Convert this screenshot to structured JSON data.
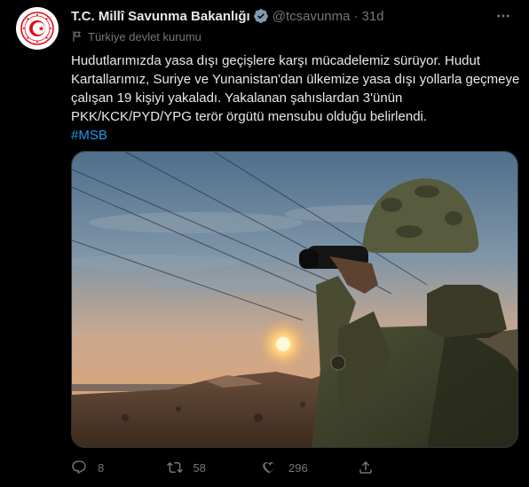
{
  "author": {
    "display_name": "T.C. Millî Savunma Bakanlığı",
    "handle": "@tcsavunma",
    "separator": "·",
    "time": "31d",
    "verified": true,
    "affiliation_label": "Türkiye devlet kurumu"
  },
  "tweet": {
    "lines": [
      "Hudutlarımızda yasa dışı geçişlere karşı mücadelemiz sürüyor. Hudut",
      "Kartallarımız, Suriye ve Yunanistan'dan ülkemize yasa dışı yollarla geçmeye",
      "çalışan 19 kişiyi yakaladı. Yakalanan şahıslardan 3'ünün",
      "PKK/KCK/PYD/YPG terör örgütü mensubu olduğu belirlendi."
    ],
    "hashtag": "#MSB"
  },
  "metrics": {
    "replies": "8",
    "retweets": "58",
    "likes": "296"
  },
  "icons": {
    "verified": "verified-badge-icon",
    "more": "more-options-icon",
    "flag": "flag-icon",
    "reply": "reply-icon",
    "retweet": "retweet-icon",
    "like": "heart-icon",
    "share": "share-icon"
  },
  "colors": {
    "background": "#000000",
    "text": "#e7e9ea",
    "secondary_text": "#71767b",
    "accent": "#1d9bf0",
    "verified": "#829aab",
    "logo_red": "#e30a17"
  }
}
